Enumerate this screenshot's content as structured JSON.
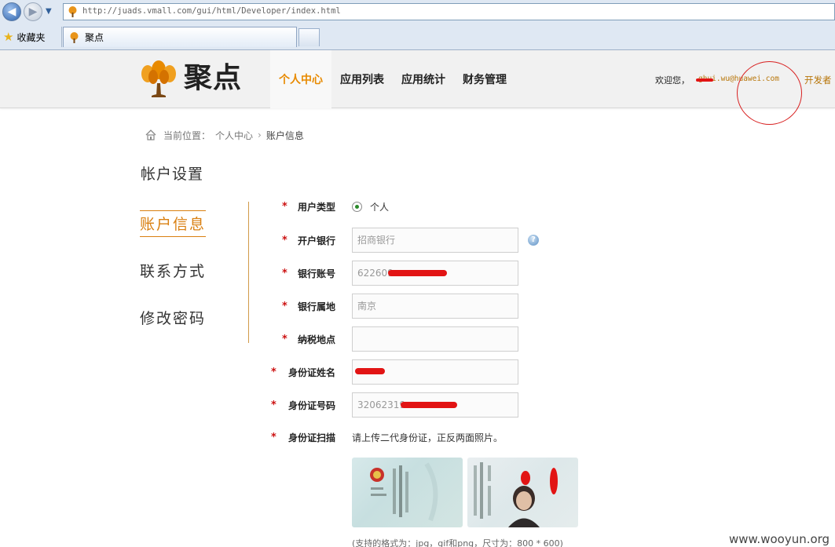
{
  "browser": {
    "url": "http://juads.vmall.com/gui/html/Developer/index.html",
    "favorites_label": "收藏夹",
    "tab_title": "聚点"
  },
  "header": {
    "logo_text": "聚点",
    "nav": [
      "个人中心",
      "应用列表",
      "应用统计",
      "财务管理"
    ],
    "welcome": "欢迎您，",
    "user_email": "ghui.wu@huawei.com",
    "developer_link": "开发者"
  },
  "breadcrumb": {
    "prefix": "当前位置：",
    "parent": "个人中心",
    "current": "账户信息"
  },
  "sidebar": {
    "title": "帐户设置",
    "items": [
      "账户信息",
      "联系方式",
      "修改密码"
    ]
  },
  "form": {
    "user_type": {
      "label": "用户类型",
      "value": "个人"
    },
    "bank": {
      "label": "开户银行",
      "value": "招商银行"
    },
    "account": {
      "label": "银行账号",
      "value": "622609"
    },
    "bank_location": {
      "label": "银行属地",
      "value": "南京"
    },
    "tax_location": {
      "label": "纳税地点",
      "value": ""
    },
    "id_name": {
      "label": "身份证姓名",
      "value": ""
    },
    "id_number": {
      "label": "身份证号码",
      "value": "32062319"
    },
    "id_scan": {
      "label": "身份证扫描",
      "hint": "请上传二代身份证，正反两面照片。"
    },
    "format_note": "(支持的格式为：jpg，gif和png，尺寸为：800 * 600)"
  },
  "required_mark": "*",
  "watermark": "www.wooyun.org",
  "colors": {
    "accent": "#e88a00",
    "required": "#cc1111",
    "redaction": "#e21414"
  }
}
